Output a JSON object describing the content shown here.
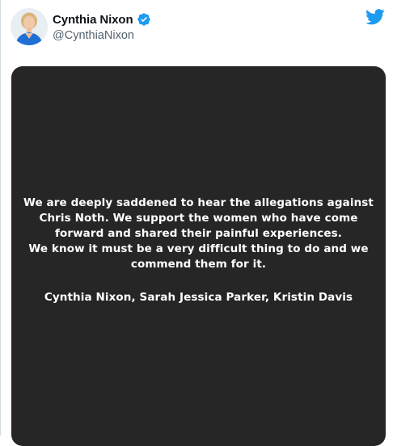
{
  "author": {
    "display_name": "Cynthia Nixon",
    "handle": "@CynthiaNixon",
    "avatar_icon": "avatar-photo",
    "verified_icon": "verified-badge-icon"
  },
  "brand": {
    "logo_icon": "twitter-bird-icon",
    "accent_color": "#1d9bf0"
  },
  "media": {
    "background_color": "#262626",
    "statement_lines": [
      "We are deeply saddened to hear the allegations against",
      "Chris Noth. We support the women who have come",
      "forward and shared their painful experiences.",
      "We know it must be a very difficult thing to do and we",
      "commend them for it."
    ],
    "signature": "Cynthia Nixon, Sarah Jessica Parker, Kristin Davis"
  }
}
